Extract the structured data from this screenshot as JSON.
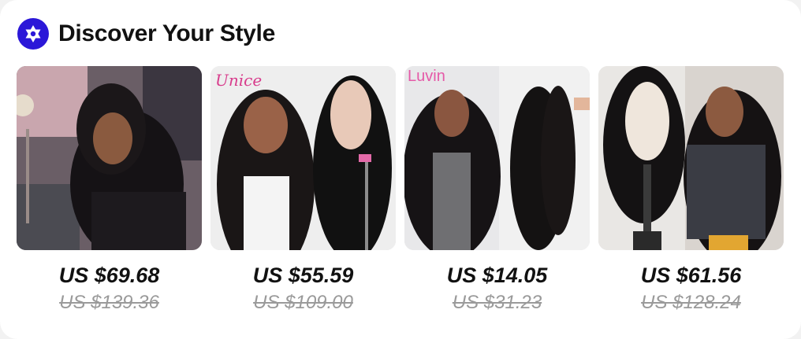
{
  "section": {
    "title": "Discover Your Style",
    "badge_icon": "star-of-david-icon",
    "accent_color": "#2b17d8"
  },
  "products": [
    {
      "price": "US $69.68",
      "original_price": "US $139.36",
      "image": "curly-hair-wig-model"
    },
    {
      "price": "US $55.59",
      "original_price": "US $109.00",
      "image": "straight-hair-lace-wig",
      "brand": "Unice"
    },
    {
      "price": "US $14.05",
      "original_price": "US $31.23",
      "image": "body-wave-hair-bundles",
      "brand": "Luvin"
    },
    {
      "price": "US $61.56",
      "original_price": "US $128.24",
      "image": "water-wave-lace-wig"
    }
  ]
}
